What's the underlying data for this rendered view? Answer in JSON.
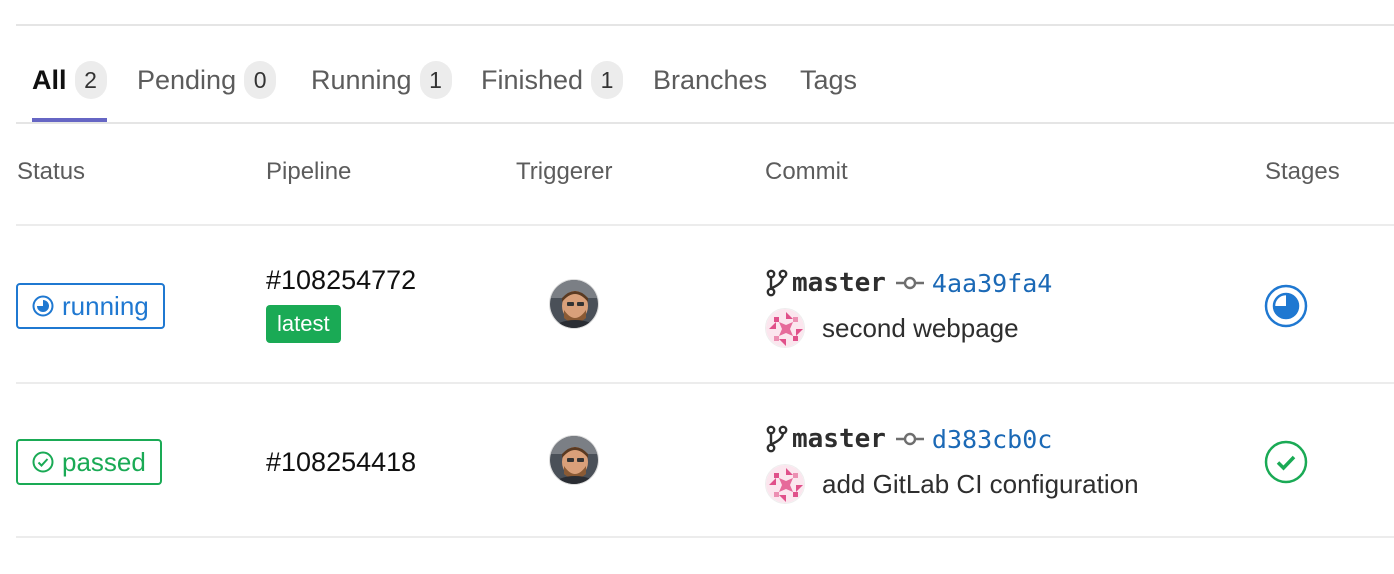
{
  "tabs": [
    {
      "label": "All",
      "count": "2"
    },
    {
      "label": "Pending",
      "count": "0"
    },
    {
      "label": "Running",
      "count": "1"
    },
    {
      "label": "Finished",
      "count": "1"
    },
    {
      "label": "Branches"
    },
    {
      "label": "Tags"
    }
  ],
  "columns": {
    "status": "Status",
    "pipeline": "Pipeline",
    "triggerer": "Triggerer",
    "commit": "Commit",
    "stages": "Stages"
  },
  "rows": [
    {
      "status": "running",
      "status_icon": "status-running-icon",
      "pipeline_id": "#108254772",
      "tag": "latest",
      "branch": "master",
      "sha": "4aa39fa4",
      "message": "second webpage",
      "stage_status": "running"
    },
    {
      "status": "passed",
      "status_icon": "status-success-icon",
      "pipeline_id": "#108254418",
      "branch": "master",
      "sha": "d383cb0c",
      "message": "add GitLab CI configuration",
      "stage_status": "passed"
    }
  ],
  "colors": {
    "running": "#1f78d1",
    "passed": "#1aaa55",
    "active_tab": "#6666c4",
    "sha_link": "#1b69b6"
  }
}
